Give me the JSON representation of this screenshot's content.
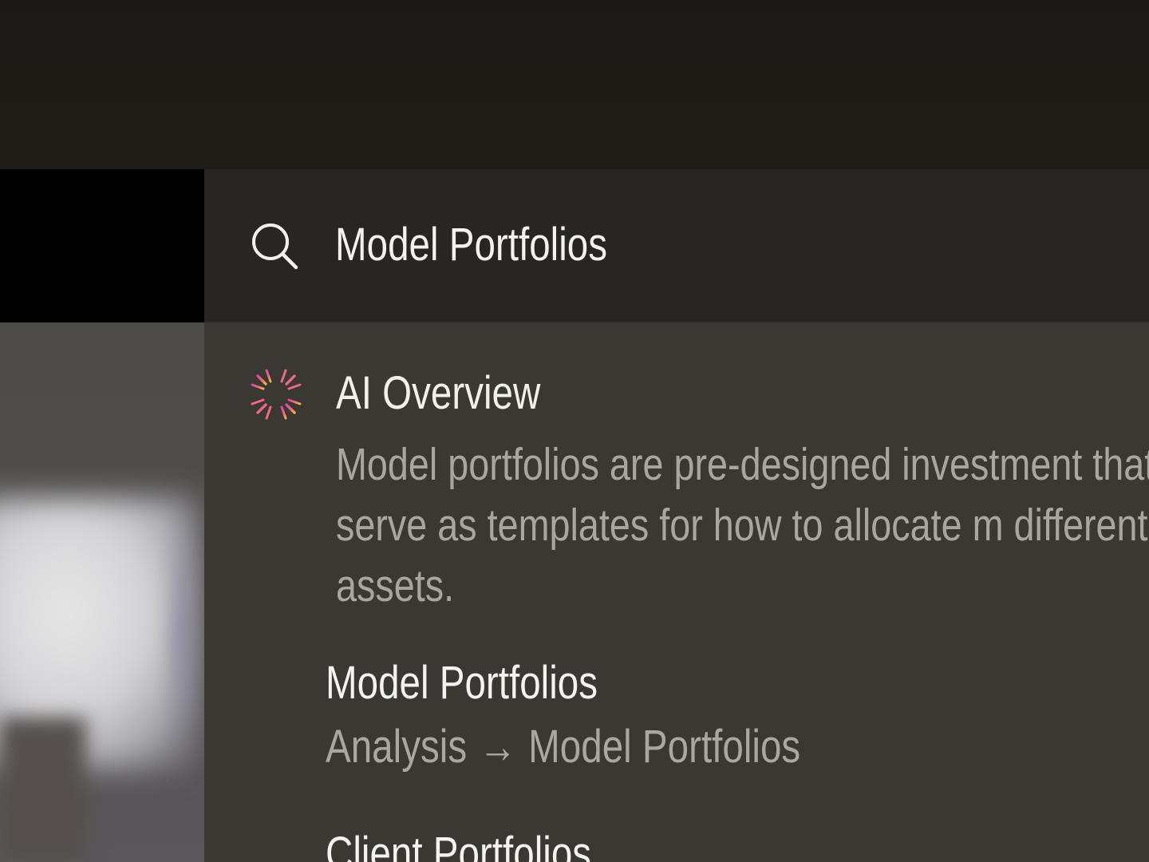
{
  "search": {
    "query": "Model Portfolios",
    "icon": "search-icon"
  },
  "ai_overview": {
    "icon": "ai-sparkle-icon",
    "title": "AI Overview",
    "summary": "Model portfolios are pre-designed investment that serve as templates for how to allocate m different assets."
  },
  "results": [
    {
      "title": "Model Portfolios",
      "path": {
        "parent": "Analysis",
        "arrow": "→",
        "current": "Model Portfolios"
      }
    },
    {
      "title": "Client Portfolios"
    }
  ],
  "colors": {
    "search_bar": "#282623",
    "results_panel": "#3b3834",
    "primary_text": "#f4f2ed",
    "secondary_text": "#aaa6a0",
    "ai_icon_pink": "#d94fa2",
    "ai_icon_orange": "#f0a24d"
  }
}
